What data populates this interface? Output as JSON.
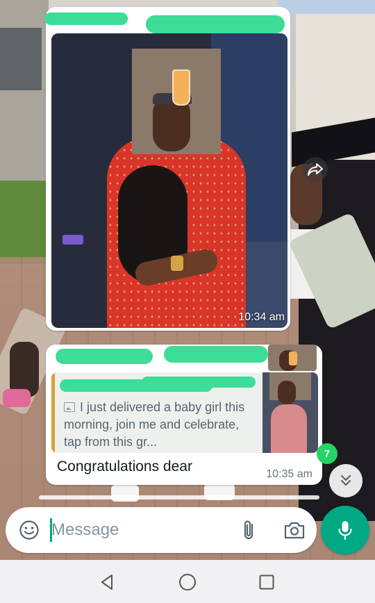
{
  "chat": {
    "messages": [
      {
        "type": "image",
        "time": "10:34 am"
      },
      {
        "type": "reply",
        "quoted": {
          "text": "I just delivered a baby girl this morning, join me and celebrate, tap from this gr..."
        },
        "text": "Congratulations dear",
        "time": "10:35 am"
      }
    ],
    "unread_count": "7"
  },
  "composer": {
    "placeholder": "Message"
  },
  "icons": {
    "emoji": "emoji-icon",
    "attach": "paperclip-icon",
    "camera": "camera-icon",
    "mic": "mic-icon",
    "forward": "forward-icon",
    "scroll_down": "double-chevron-down-icon",
    "nav_back": "back-triangle-icon",
    "nav_home": "home-circle-icon",
    "nav_recents": "recents-square-icon"
  },
  "colors": {
    "accent": "#00a884",
    "badge": "#25d366",
    "redaction": "#3ddc97",
    "quote_bar": "#d9a13c"
  }
}
